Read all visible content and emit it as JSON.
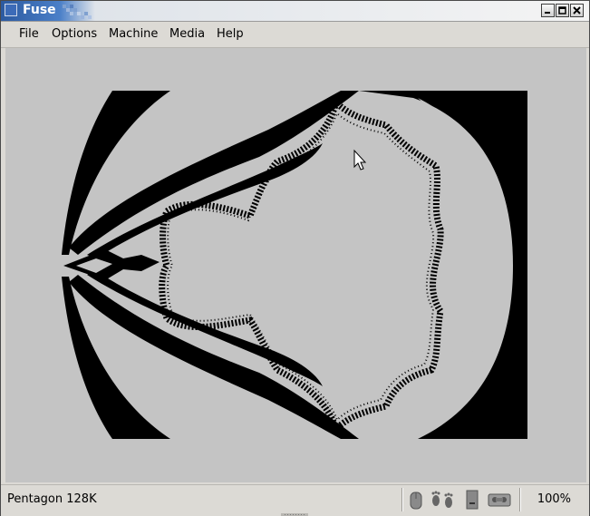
{
  "window": {
    "title": "Fuse"
  },
  "menu": {
    "items": [
      {
        "label": "File"
      },
      {
        "label": "Options"
      },
      {
        "label": "Machine"
      },
      {
        "label": "Media"
      },
      {
        "label": "Help"
      }
    ]
  },
  "emulator": {
    "screen_colors": {
      "paper": "#c4c4c4",
      "ink": "#000000",
      "border": "#c4c4c4"
    },
    "image_content": "fractal"
  },
  "status": {
    "machine": "Pentagon 128K",
    "zoom": "100%",
    "icons": [
      "mouse-icon",
      "joystick-footprints-icon",
      "disk-drive-icon",
      "tape-icon"
    ]
  }
}
